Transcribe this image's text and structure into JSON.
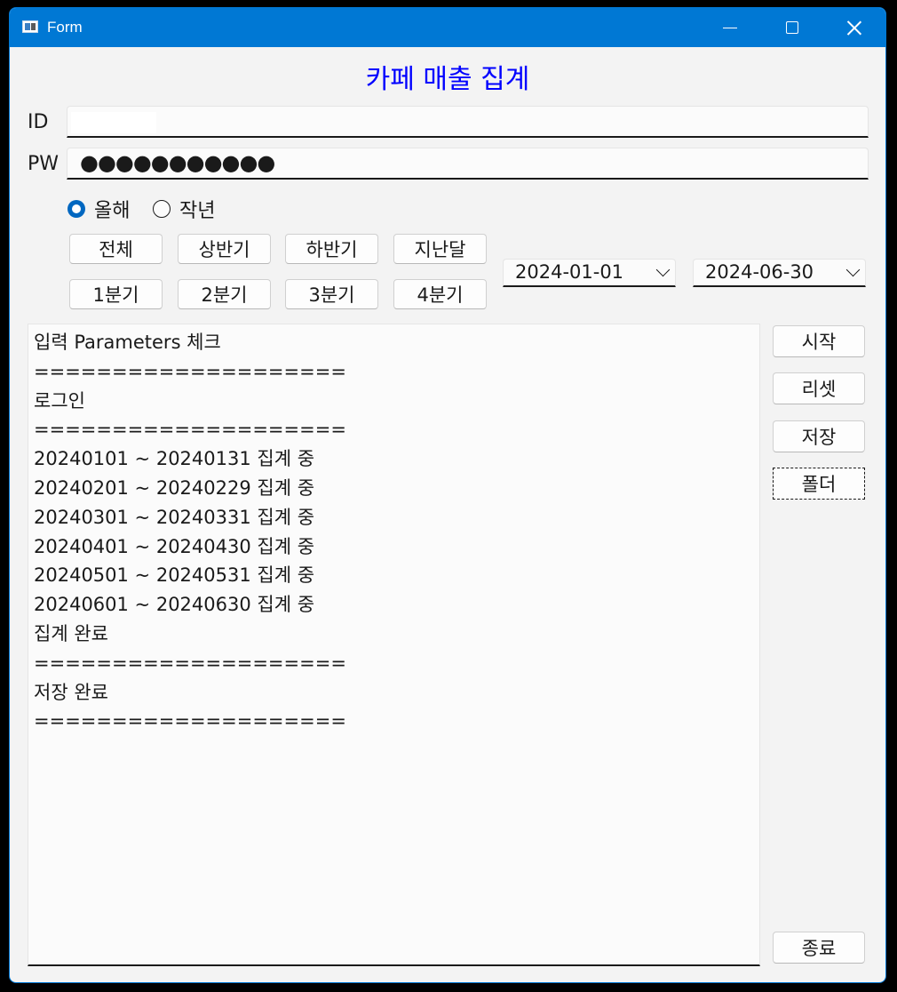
{
  "window": {
    "title": "Form"
  },
  "form": {
    "title": "카페 매출 집계",
    "id_label": "ID",
    "id_value": "",
    "pw_label": "PW",
    "pw_value": "●●●●●●●●●●●"
  },
  "year_options": [
    {
      "label": "올해",
      "checked": true
    },
    {
      "label": "작년",
      "checked": false
    }
  ],
  "period_buttons": {
    "row1": [
      "전체",
      "상반기",
      "하반기",
      "지난달"
    ],
    "row2": [
      "1분기",
      "2분기",
      "3분기",
      "4분기"
    ]
  },
  "date_range": {
    "start": "2024-01-01",
    "end": "2024-06-30"
  },
  "actions": {
    "start": "시작",
    "reset": "리셋",
    "save": "저장",
    "folder": "폴더",
    "exit": "종료"
  },
  "log": [
    "입력 Parameters 체크",
    "====================",
    "로그인",
    "====================",
    "20240101 ~ 20240131 집계 중",
    "20240201 ~ 20240229 집계 중",
    "20240301 ~ 20240331 집계 중",
    "20240401 ~ 20240430 집계 중",
    "20240501 ~ 20240531 집계 중",
    "20240601 ~ 20240630 집계 중",
    "집계 완료",
    "====================",
    "저장 완료",
    "===================="
  ],
  "colors": {
    "titlebar": "#0078d4",
    "form_title": "#0000ff",
    "radio_accent": "#0067c0"
  }
}
